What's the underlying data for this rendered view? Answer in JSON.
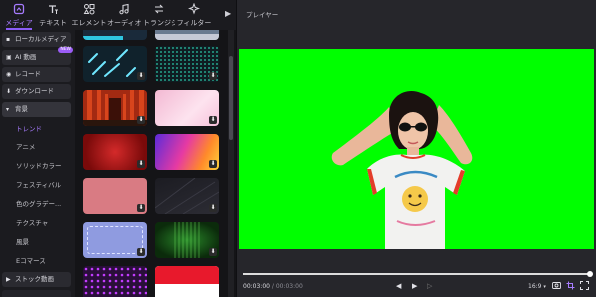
{
  "toolbar": {
    "tabs": [
      {
        "label": "メディア",
        "icon": "media-icon",
        "active": true
      },
      {
        "label": "テキスト",
        "icon": "text-icon"
      },
      {
        "label": "エレメント",
        "icon": "element-icon"
      },
      {
        "label": "オーディオ",
        "icon": "audio-icon"
      },
      {
        "label": "トランジション",
        "icon": "transition-icon"
      },
      {
        "label": "フィルター",
        "icon": "filter-icon"
      }
    ]
  },
  "sidebar": {
    "categories": [
      {
        "label": "ローカルメディア"
      },
      {
        "label": "AI 動画",
        "badge": "NEW"
      },
      {
        "label": "レコード"
      },
      {
        "label": "ダウンロード"
      },
      {
        "label": "背景"
      }
    ],
    "subitems": [
      "トレンド",
      "アニメ",
      "ソリッドカラー",
      "フェスティバル",
      "色のグラデー...",
      "テクスチャ",
      "風景",
      "Eコマース"
    ],
    "bottom_category": {
      "label": "ストック動画"
    }
  },
  "player": {
    "title": "プレイヤー",
    "current_time": "00:03:00",
    "separator": "/",
    "total_time": "00:03:00",
    "aspect_ratio": "16:9",
    "progress": 1.0
  },
  "colors": {
    "accent": "#8b5cf6",
    "chroma_green": "#00ff00"
  }
}
